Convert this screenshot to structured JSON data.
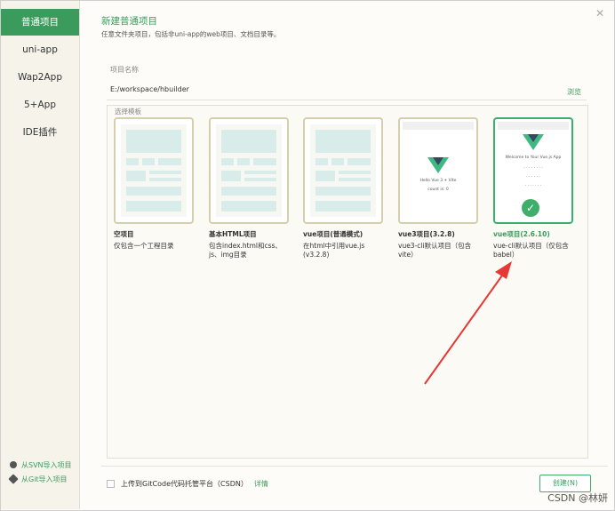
{
  "sidebar": {
    "items": [
      {
        "label": "普通项目",
        "active": true
      },
      {
        "label": "uni-app"
      },
      {
        "label": "Wap2App"
      },
      {
        "label": "5+App"
      },
      {
        "label": "IDE插件"
      }
    ],
    "bottom": [
      {
        "label": "从SVN导入项目",
        "icon": "svn-icon"
      },
      {
        "label": "从Git导入项目",
        "icon": "git-icon"
      }
    ]
  },
  "header": {
    "title": "新建普通项目",
    "subtitle": "任意文件夹项目，包括非uni-app的web项目、文档目录等。",
    "close": "✕"
  },
  "form": {
    "name_label": "项目名称",
    "path_value": "E:/workspace/hbuilder",
    "browse": "浏览",
    "template_label": "选择模板"
  },
  "templates": [
    {
      "name": "空项目",
      "desc": "仅包含一个工程目录"
    },
    {
      "name": "基本HTML项目",
      "desc": "包含index.html和css、js、img目录"
    },
    {
      "name": "vue项目(普通模式)",
      "desc": "在html中引用vue.js (v3.2.8)"
    },
    {
      "name": "vue3项目(3.2.8)",
      "desc": "vue3-cli默认项目（包含vite）"
    },
    {
      "name": "vue项目(2.6.10)",
      "desc": "vue-cli默认项目（仅包含babel）",
      "selected": true
    }
  ],
  "footer": {
    "upload_label": "上传到GitCode代码托管平台（CSDN）",
    "detail": "详情",
    "create_button": "创建(N)"
  },
  "watermark": "CSDN @林妍",
  "colors": {
    "accent": "#3b9b5c",
    "arrow": "#e53935"
  }
}
